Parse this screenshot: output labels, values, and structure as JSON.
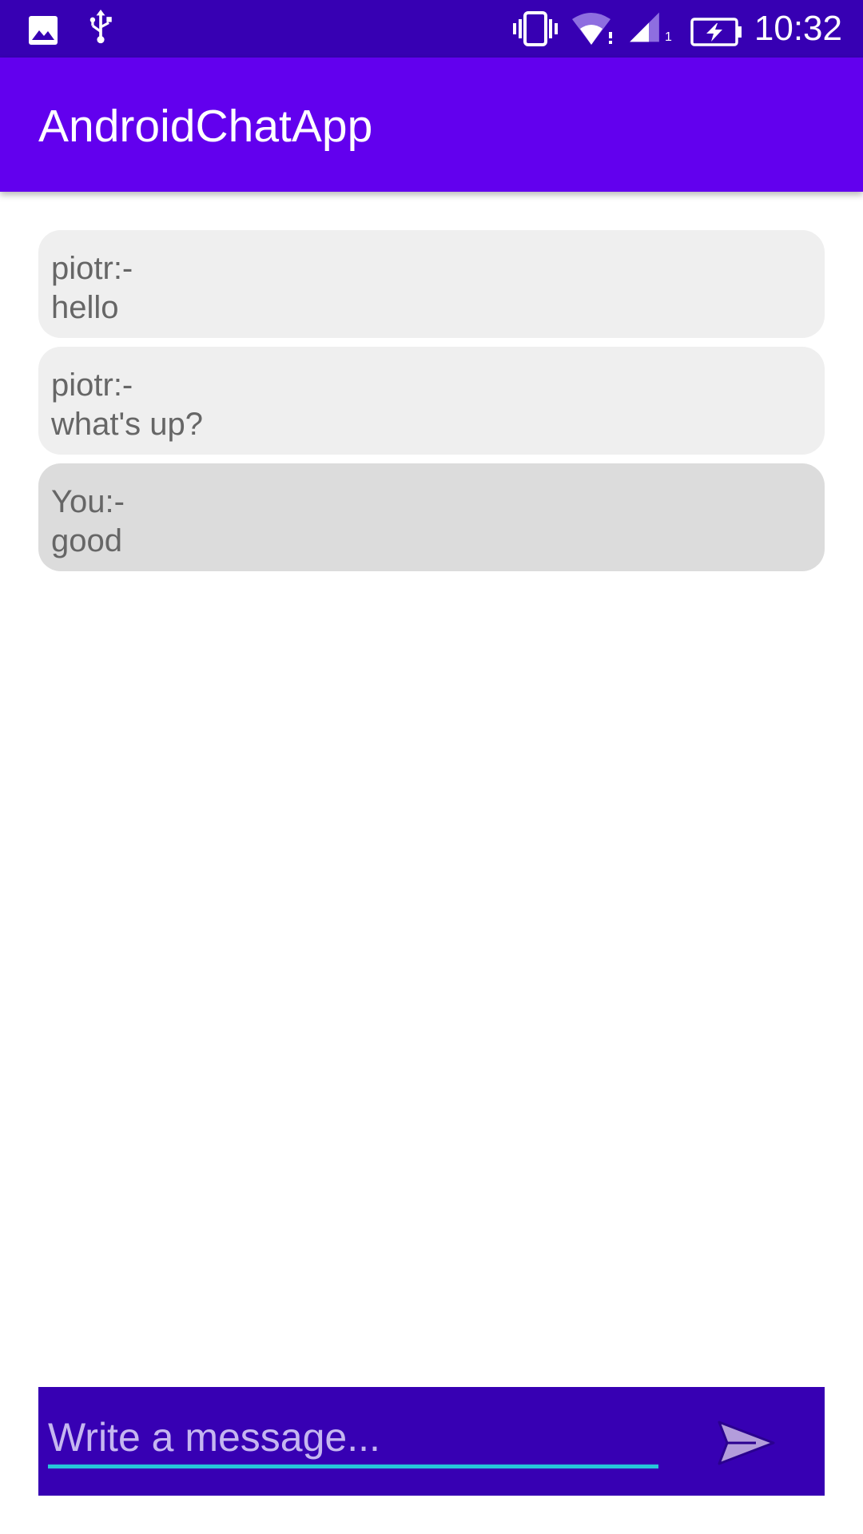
{
  "status_bar": {
    "time": "10:32",
    "icons": [
      "image-icon",
      "usb-icon",
      "vibrate-icon",
      "wifi-icon",
      "signal-icon",
      "battery-charging-icon"
    ],
    "signal_label": "1"
  },
  "app_bar": {
    "title": "AndroidChatApp"
  },
  "messages": [
    {
      "sender": "piotr:-",
      "text": "hello",
      "type": "incoming"
    },
    {
      "sender": "piotr:-",
      "text": "what's up?",
      "type": "incoming"
    },
    {
      "sender": "You:-",
      "text": "good",
      "type": "outgoing"
    }
  ],
  "composer": {
    "placeholder": "Write a message...",
    "value": "",
    "send_icon": "send-icon"
  },
  "colors": {
    "status_bar": "#3700b3",
    "app_bar": "#6200ee",
    "composer": "#3700b3",
    "input_underline": "#26c6da",
    "incoming_bubble": "#efefef",
    "outgoing_bubble": "#dcdcdc",
    "message_text": "#666666",
    "send_icon": "#b39ddb"
  }
}
